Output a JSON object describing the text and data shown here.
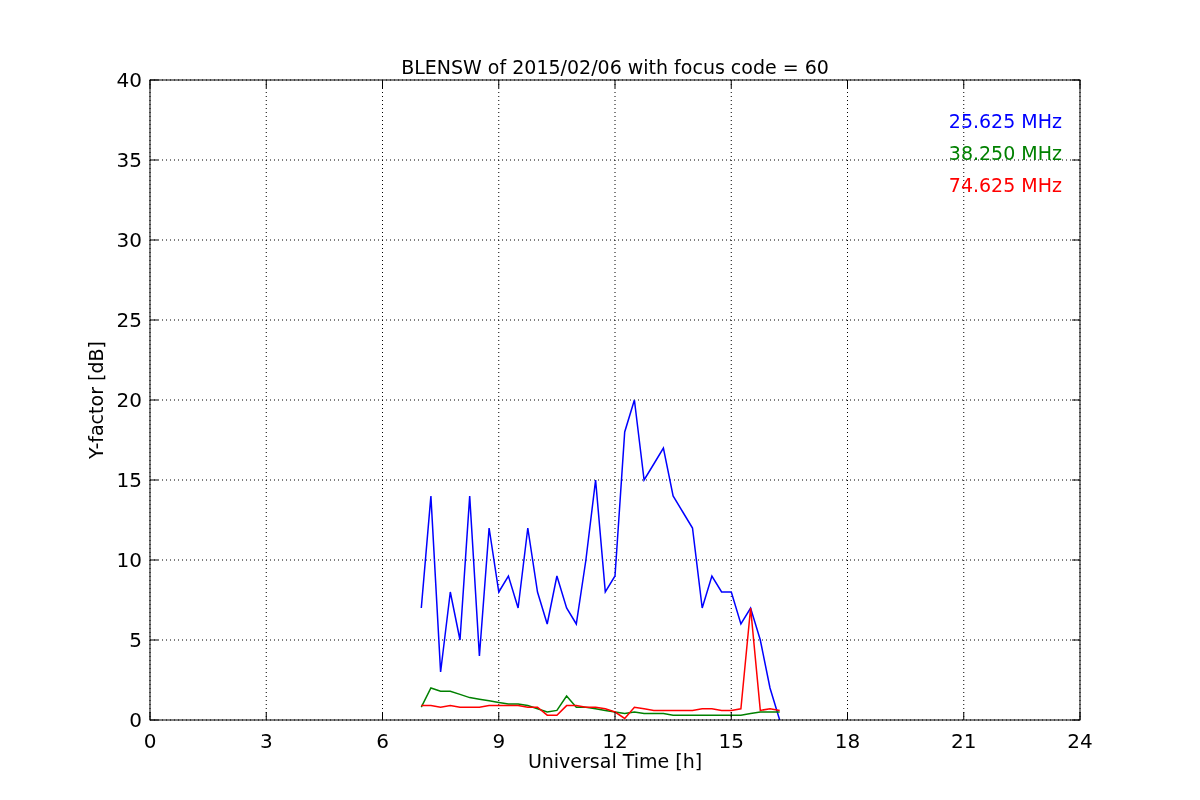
{
  "chart_data": {
    "type": "line",
    "title": "BLENSW of 2015/02/06 with focus code = 60",
    "xlabel": "Universal Time [h]",
    "ylabel": "Y-factor [dB]",
    "x": [
      7.0,
      7.25,
      7.5,
      7.75,
      8.0,
      8.25,
      8.5,
      8.75,
      9.0,
      9.25,
      9.5,
      9.75,
      10.0,
      10.25,
      10.5,
      10.75,
      11.0,
      11.25,
      11.5,
      11.75,
      12.0,
      12.25,
      12.5,
      12.75,
      13.0,
      13.25,
      13.5,
      13.75,
      14.0,
      14.25,
      14.5,
      14.75,
      15.0,
      15.25,
      15.5,
      15.75,
      16.0,
      16.25
    ],
    "series": [
      {
        "name": "25.625 MHz",
        "color": "#0000ff",
        "values": [
          7,
          14,
          3,
          8,
          5,
          14,
          4,
          12,
          8,
          9,
          7,
          12,
          8,
          6,
          9,
          7,
          6,
          10,
          15,
          8,
          9,
          18,
          20,
          15,
          16,
          17,
          14,
          13,
          12,
          7,
          9,
          8,
          8,
          6,
          7,
          5,
          2,
          0
        ]
      },
      {
        "name": "38.250 MHz",
        "color": "#008000",
        "values": [
          0.8,
          2,
          1.8,
          1.8,
          1.6,
          1.4,
          1.3,
          1.2,
          1.1,
          1.0,
          1.0,
          0.9,
          0.7,
          0.5,
          0.6,
          1.5,
          0.8,
          0.8,
          0.7,
          0.6,
          0.5,
          0.4,
          0.5,
          0.4,
          0.4,
          0.4,
          0.3,
          0.3,
          0.3,
          0.3,
          0.3,
          0.3,
          0.3,
          0.3,
          0.4,
          0.5,
          0.5,
          0.5
        ]
      },
      {
        "name": "74.625 MHz",
        "color": "#ff0000",
        "values": [
          0.9,
          0.9,
          0.8,
          0.9,
          0.8,
          0.8,
          0.8,
          0.9,
          0.9,
          0.9,
          0.9,
          0.8,
          0.8,
          0.3,
          0.3,
          0.9,
          0.9,
          0.8,
          0.8,
          0.7,
          0.5,
          0.1,
          0.8,
          0.7,
          0.6,
          0.6,
          0.6,
          0.6,
          0.6,
          0.7,
          0.7,
          0.6,
          0.6,
          0.7,
          7,
          0.6,
          0.7,
          0.6
        ]
      }
    ],
    "xlim": [
      0,
      24
    ],
    "ylim": [
      0,
      40
    ],
    "xticks": [
      0,
      3,
      6,
      9,
      12,
      15,
      18,
      21,
      24
    ],
    "yticks": [
      0,
      5,
      10,
      15,
      20,
      25,
      30,
      35,
      40
    ],
    "grid": true
  }
}
